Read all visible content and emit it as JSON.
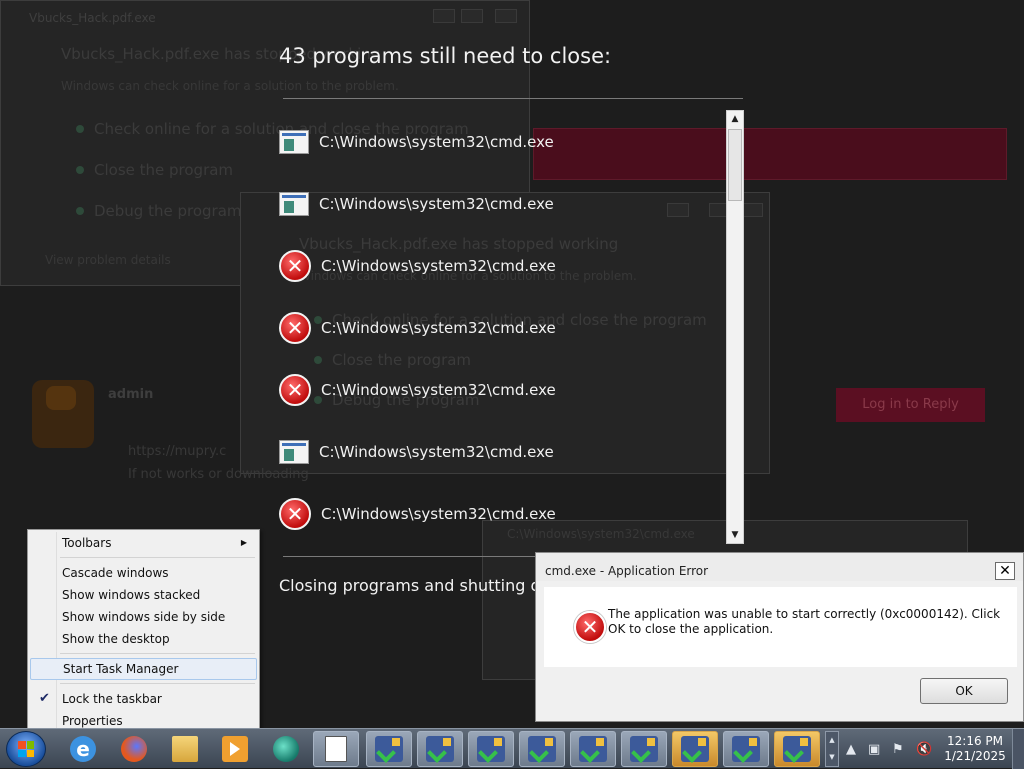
{
  "background": {
    "window1_title": "Vbucks_Hack.pdf.exe",
    "window1_heading": "Vbucks_Hack.pdf.exe has stopped working",
    "window1_sub": "Windows can check online for a solution to the problem.",
    "window1_options": [
      "Check online for a solution and close the program",
      "Close the program",
      "Debug the program"
    ],
    "window1_details": "View problem details",
    "window2_heading": "Vbucks_Hack.pdf.exe has stopped working",
    "window2_sub": "Windows can check online for a solution to the problem.",
    "window2_options": [
      "Check online for a solution and close the program",
      "Close the program",
      "Debug the program"
    ],
    "forum_user": "admin",
    "forum_line1": "https://mupry.c",
    "forum_line2": "If not works or downloading",
    "login_button": "Log in to Reply",
    "window3_title": "C:\\Windows\\system32\\cmd.exe"
  },
  "shutdown": {
    "title": "43 programs still need to close:",
    "programs": [
      {
        "icon": "cmd-icon",
        "label": "C:\\Windows\\system32\\cmd.exe"
      },
      {
        "icon": "cmd-icon",
        "label": "C:\\Windows\\system32\\cmd.exe"
      },
      {
        "icon": "error-icon",
        "label": "C:\\Windows\\system32\\cmd.exe"
      },
      {
        "icon": "error-icon",
        "label": "C:\\Windows\\system32\\cmd.exe"
      },
      {
        "icon": "error-icon",
        "label": "C:\\Windows\\system32\\cmd.exe"
      },
      {
        "icon": "cmd-icon",
        "label": "C:\\Windows\\system32\\cmd.exe"
      },
      {
        "icon": "error-icon",
        "label": "C:\\Windows\\system32\\cmd.exe"
      }
    ],
    "status": "Closing programs and shutting down"
  },
  "dialog": {
    "title": "cmd.exe - Application Error",
    "close_glyph": "✕",
    "message": "The application was unable to start correctly (0xc0000142). Click OK to close the application.",
    "ok_label": "OK"
  },
  "context_menu": {
    "toolbars": "Toolbars",
    "cascade": "Cascade windows",
    "stacked": "Show windows stacked",
    "side_by_side": "Show windows side by side",
    "desktop": "Show the desktop",
    "task_manager": "Start Task Manager",
    "lock": "Lock the taskbar",
    "properties": "Properties"
  },
  "taskbar": {
    "pinned": [
      "internet-explorer-icon",
      "firefox-icon",
      "folder-icon",
      "media-player-icon",
      "teal-app-icon",
      "notepad-icon"
    ],
    "running_windows": 9,
    "hot_windows": [
      6,
      8
    ],
    "time": "12:16 PM",
    "date": "1/21/2025"
  },
  "colors": {
    "overlay_bg": "#1d1d1d",
    "error_red": "#c10d0d",
    "taskbar": "#4a5464",
    "forum_button": "#5b0f22"
  }
}
